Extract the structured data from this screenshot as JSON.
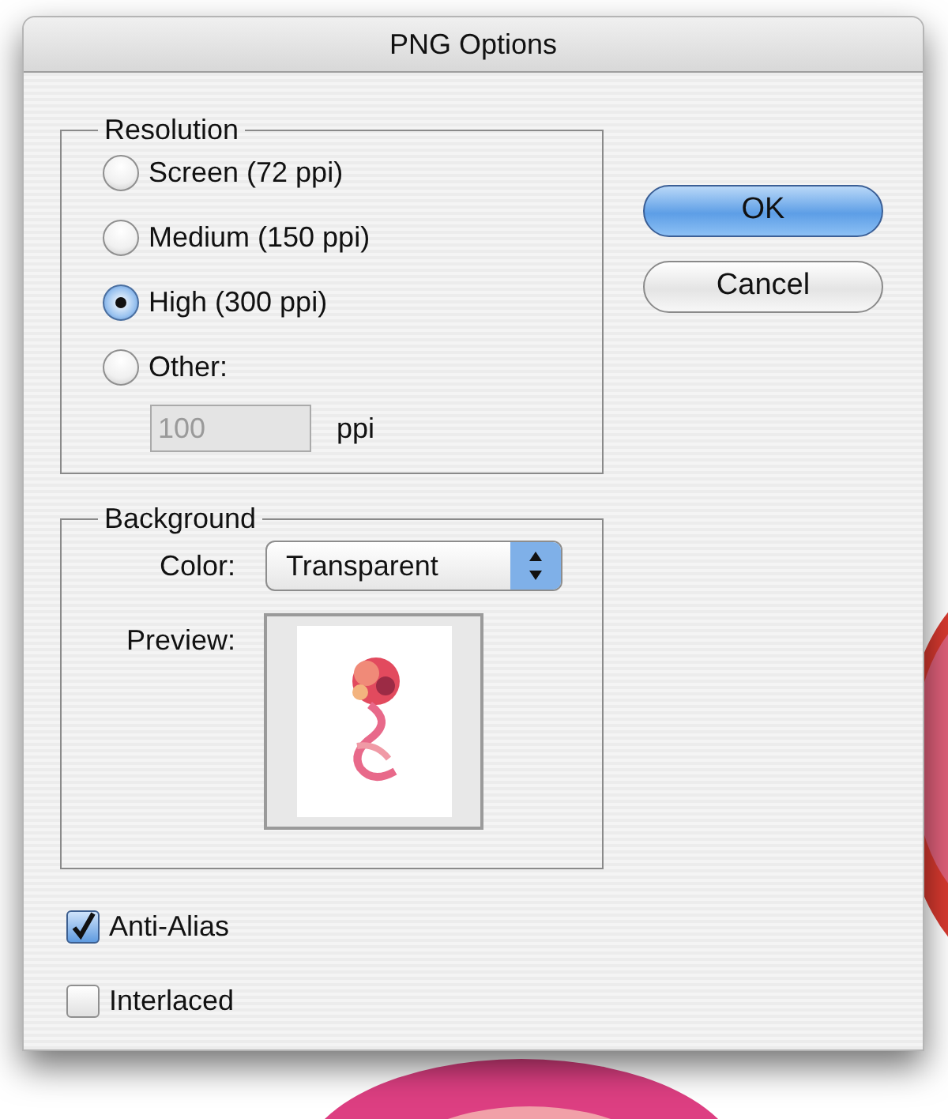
{
  "window": {
    "title": "PNG Options"
  },
  "resolution": {
    "title": "Resolution",
    "options": [
      {
        "label": "Screen (72 ppi)",
        "selected": false
      },
      {
        "label": "Medium (150 ppi)",
        "selected": false
      },
      {
        "label": "High (300 ppi)",
        "selected": true
      },
      {
        "label": "Other:",
        "selected": false
      }
    ],
    "other_field": {
      "value": "100",
      "disabled": true
    },
    "unit": "ppi"
  },
  "background": {
    "title": "Background",
    "color_label": "Color:",
    "color_value": "Transparent",
    "preview_label": "Preview:"
  },
  "checkboxes": [
    {
      "label": "Anti-Alias",
      "checked": true
    },
    {
      "label": "Interlaced",
      "checked": false
    }
  ],
  "buttons": [
    {
      "label": "OK",
      "default": true
    },
    {
      "label": "Cancel",
      "default": false
    }
  ]
}
